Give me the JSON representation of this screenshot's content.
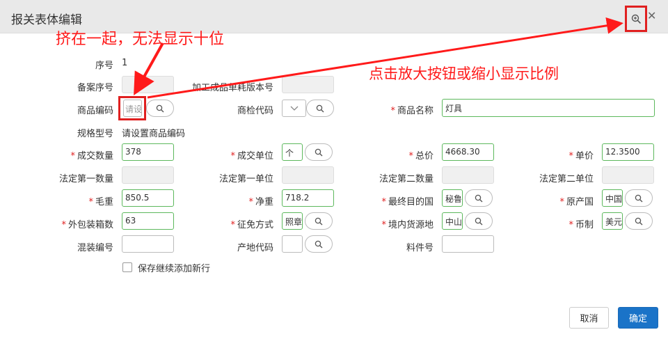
{
  "dialog": {
    "title": "报关表体编辑"
  },
  "annotations": {
    "squeeze": "挤在一起，无法显示十位",
    "zoom_hint": "点击放大按钮或缩小显示比例"
  },
  "form": {
    "seq": {
      "label": "序号",
      "value": "1"
    },
    "record_seq": {
      "label": "备案序号",
      "value": ""
    },
    "process_version": {
      "label": "加工成品单耗版本号",
      "value": ""
    },
    "goods_code": {
      "label": "商品编码",
      "value": "请设"
    },
    "inspection_code": {
      "label": "商检代码",
      "value": ""
    },
    "goods_name": {
      "label": "商品名称",
      "value": "灯具"
    },
    "spec_model": {
      "label": "规格型号",
      "value": "请设置商品编码"
    },
    "deal_qty": {
      "label": "成交数量",
      "value": "378"
    },
    "deal_unit": {
      "label": "成交单位",
      "value": "个"
    },
    "total_price": {
      "label": "总价",
      "value": "4668.30"
    },
    "unit_price": {
      "label": "单价",
      "value": "12.3500"
    },
    "legal_qty1": {
      "label": "法定第一数量",
      "value": ""
    },
    "legal_unit1": {
      "label": "法定第一单位",
      "value": ""
    },
    "legal_qty2": {
      "label": "法定第二数量",
      "value": ""
    },
    "legal_unit2": {
      "label": "法定第二单位",
      "value": ""
    },
    "gross_weight": {
      "label": "毛重",
      "value": "850.5"
    },
    "net_weight": {
      "label": "净重",
      "value": "718.2"
    },
    "dest_country": {
      "label": "最终目的国",
      "value": "秘鲁"
    },
    "origin_country": {
      "label": "原产国",
      "value": "中国"
    },
    "packages": {
      "label": "外包装箱数",
      "value": "63"
    },
    "exemption": {
      "label": "征免方式",
      "value": "照章"
    },
    "domestic_source": {
      "label": "境内货源地",
      "value": "中山"
    },
    "currency": {
      "label": "币制",
      "value": "美元"
    },
    "mixed_no": {
      "label": "混装编号",
      "value": ""
    },
    "origin_code": {
      "label": "产地代码",
      "value": ""
    },
    "part_no": {
      "label": "料件号",
      "value": ""
    },
    "keep_adding": {
      "label": "保存继续添加新行"
    }
  },
  "buttons": {
    "cancel": "取消",
    "confirm": "确定"
  },
  "colors": {
    "required": "#e02020",
    "valid_border": "#5cb85c",
    "primary": "#1a73c8",
    "annotation": "#ff1a1a"
  }
}
